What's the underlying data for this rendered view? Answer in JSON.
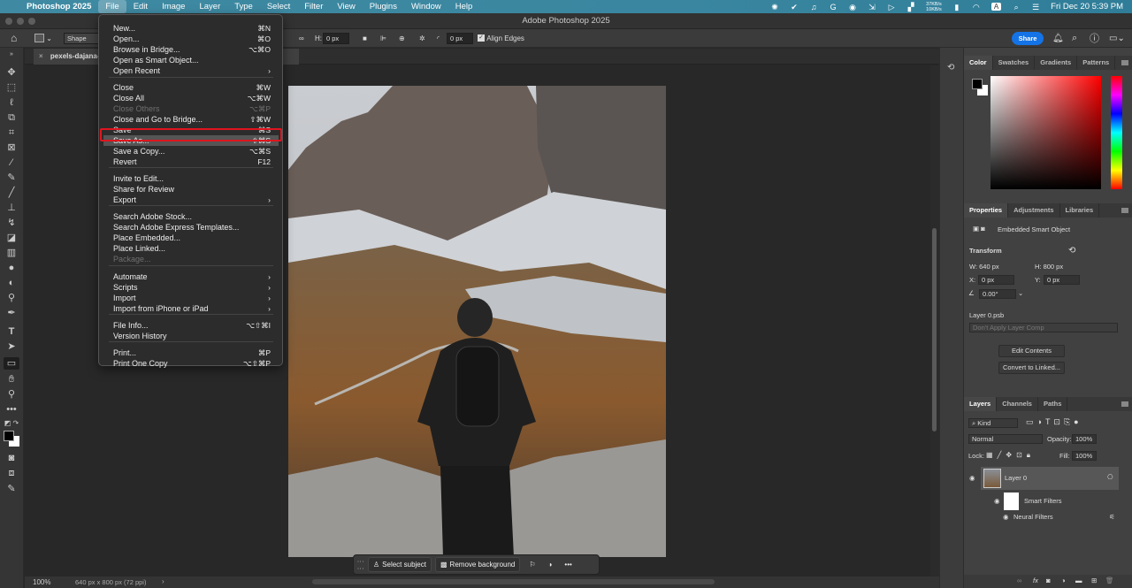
{
  "macbar": {
    "app_name": "Photoshop 2025",
    "menus": [
      "File",
      "Edit",
      "Image",
      "Layer",
      "Type",
      "Select",
      "Filter",
      "View",
      "Plugins",
      "Window",
      "Help"
    ],
    "active_menu": "File",
    "net_up": "37KB/s",
    "net_down": "10KB/s",
    "input_source": "A",
    "datetime": "Fri Dec 20  5:39 PM"
  },
  "window": {
    "title": "Adobe Photoshop 2025"
  },
  "options": {
    "shape_mode": "Shape",
    "h_label": "H:",
    "h_value": "0 px",
    "radius_value": "0 px",
    "align_edges_label": "Align Edges",
    "align_edges_checked": true,
    "share_label": "Share"
  },
  "document": {
    "tab_name": "pexels-dajana-re"
  },
  "status": {
    "zoom": "100%",
    "doc_info": "640 px x 800 px (72 ppi)"
  },
  "context_bar": {
    "select_subject": "Select subject",
    "remove_background": "Remove background"
  },
  "file_menu": {
    "items": [
      {
        "label": "New...",
        "shortcut": "⌘N"
      },
      {
        "label": "Open...",
        "shortcut": "⌘O"
      },
      {
        "label": "Browse in Bridge...",
        "shortcut": "⌥⌘O"
      },
      {
        "label": "Open as Smart Object...",
        "shortcut": ""
      },
      {
        "label": "Open Recent",
        "shortcut": "›"
      },
      {
        "label": "Close",
        "shortcut": "⌘W"
      },
      {
        "label": "Close All",
        "shortcut": "⌥⌘W"
      },
      {
        "label": "Close Others",
        "shortcut": "⌥⌘P",
        "disabled": true
      },
      {
        "label": "Close and Go to Bridge...",
        "shortcut": "⇧⌘W"
      },
      {
        "label": "Save",
        "shortcut": "⌘S"
      },
      {
        "label": "Save As...",
        "shortcut": "⇧⌘S",
        "highlighted": true
      },
      {
        "label": "Save a Copy...",
        "shortcut": "⌥⌘S"
      },
      {
        "label": "Revert",
        "shortcut": "F12"
      },
      {
        "label": "Invite to Edit...",
        "shortcut": ""
      },
      {
        "label": "Share for Review",
        "shortcut": ""
      },
      {
        "label": "Export",
        "shortcut": "›"
      },
      {
        "label": "Search Adobe Stock...",
        "shortcut": ""
      },
      {
        "label": "Search Adobe Express Templates...",
        "shortcut": ""
      },
      {
        "label": "Place Embedded...",
        "shortcut": ""
      },
      {
        "label": "Place Linked...",
        "shortcut": ""
      },
      {
        "label": "Package...",
        "shortcut": "",
        "disabled": true
      },
      {
        "label": "Automate",
        "shortcut": "›"
      },
      {
        "label": "Scripts",
        "shortcut": "›"
      },
      {
        "label": "Import",
        "shortcut": "›"
      },
      {
        "label": "Import from iPhone or iPad",
        "shortcut": "›"
      },
      {
        "label": "File Info...",
        "shortcut": "⌥⇧⌘I"
      },
      {
        "label": "Version History",
        "shortcut": ""
      },
      {
        "label": "Print...",
        "shortcut": "⌘P"
      },
      {
        "label": "Print One Copy",
        "shortcut": "⌥⇧⌘P"
      }
    ]
  },
  "color_panel": {
    "tabs": [
      "Color",
      "Swatches",
      "Gradients",
      "Patterns"
    ],
    "active": "Color",
    "hue_color": "#ff0000"
  },
  "properties_panel": {
    "tabs": [
      "Properties",
      "Adjustments",
      "Libraries"
    ],
    "active": "Properties",
    "object_type": "Embedded Smart Object",
    "section": "Transform",
    "w": "W:  640 px",
    "h": "H:  800 px",
    "x_label": "X:",
    "x_value": "0 px",
    "y_label": "Y:",
    "y_value": "0 px",
    "angle": "0.00°",
    "file_name": "Layer 0.psb",
    "layer_comp": "Don't Apply Layer Comp",
    "edit_contents": "Edit Contents",
    "convert_linked": "Convert to Linked..."
  },
  "layers_panel": {
    "tabs": [
      "Layers",
      "Channels",
      "Paths"
    ],
    "active": "Layers",
    "filter_kind": "Kind",
    "blend_mode": "Normal",
    "opacity_label": "Opacity:",
    "opacity": "100%",
    "lock_label": "Lock:",
    "fill_label": "Fill:",
    "fill": "100%",
    "layers": [
      {
        "name": "Layer 0"
      }
    ],
    "smart_filters_label": "Smart Filters",
    "neural_filters_label": "Neural Filters"
  },
  "colors": {
    "accent": "#1473e6",
    "highlight_box": "#e0151f"
  }
}
